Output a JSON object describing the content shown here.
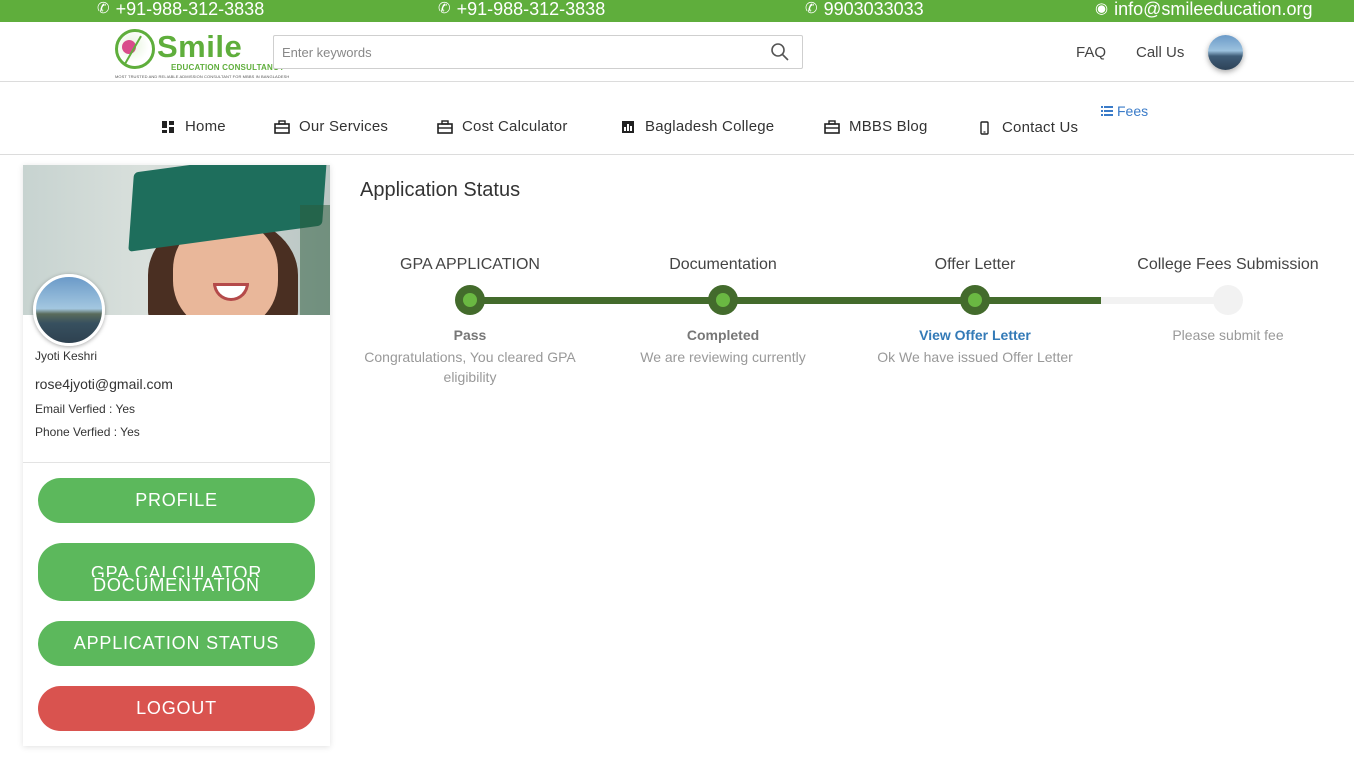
{
  "topbar": {
    "phone1": "+91-988-312-3838",
    "phone2": "+91-988-312-3838",
    "phone3": "9903033033",
    "email": "info@smileeducation.org"
  },
  "header": {
    "logo_brand": "Smile",
    "logo_sub": "EDUCATION CONSULTANCY",
    "logo_tagline": "MOST TRUSTED AND RELIABLE ADMISSION CONSULTANT FOR MBBS IN BANGLADESH",
    "search_placeholder": "Enter keywords",
    "faq": "FAQ",
    "call_us": "Call Us"
  },
  "nav": {
    "items": [
      {
        "label": "Home",
        "icon": "dashboard-icon"
      },
      {
        "label": "Our Services",
        "icon": "briefcase-icon"
      },
      {
        "label": "Cost Calculator",
        "icon": "briefcase-icon"
      },
      {
        "label": "Bagladesh College",
        "icon": "bar-chart-icon"
      },
      {
        "label": "MBBS Blog",
        "icon": "briefcase-icon"
      },
      {
        "label": "Contact Us",
        "icon": "mobile-icon"
      }
    ],
    "fees": "Fees"
  },
  "sidebar": {
    "name": "Jyoti Keshri",
    "email": "rose4jyoti@gmail.com",
    "email_verified": "Email Verfied : Yes",
    "phone_verified": "Phone Verfied : Yes",
    "buttons": {
      "profile": "PROFILE",
      "gpa_calculator": "GPA CALCULATOR",
      "documentation": "DOCUMENTATION",
      "application_status": "APPLICATION STATUS",
      "logout": "LOGOUT"
    }
  },
  "main": {
    "title": "Application Status",
    "progress_fraction": 0.833,
    "steps": [
      {
        "title": "GPA APPLICATION",
        "status": "Pass",
        "desc": "Congratulations, You cleared GPA eligibility",
        "done": true
      },
      {
        "title": "Documentation",
        "status": "Completed",
        "desc": "We are reviewing currently",
        "done": true
      },
      {
        "title": "Offer Letter",
        "status": "View Offer Letter",
        "desc": "Ok We have issued Offer Letter",
        "done": true
      },
      {
        "title": "College Fees Submission",
        "status": "Please submit fee",
        "desc": "",
        "done": false
      }
    ]
  },
  "colors": {
    "brand_green": "#5fae3c",
    "button_green": "#5cb85c",
    "logout_red": "#d9534f",
    "progress_dark": "#436b2c",
    "link_blue": "#337ab7"
  }
}
